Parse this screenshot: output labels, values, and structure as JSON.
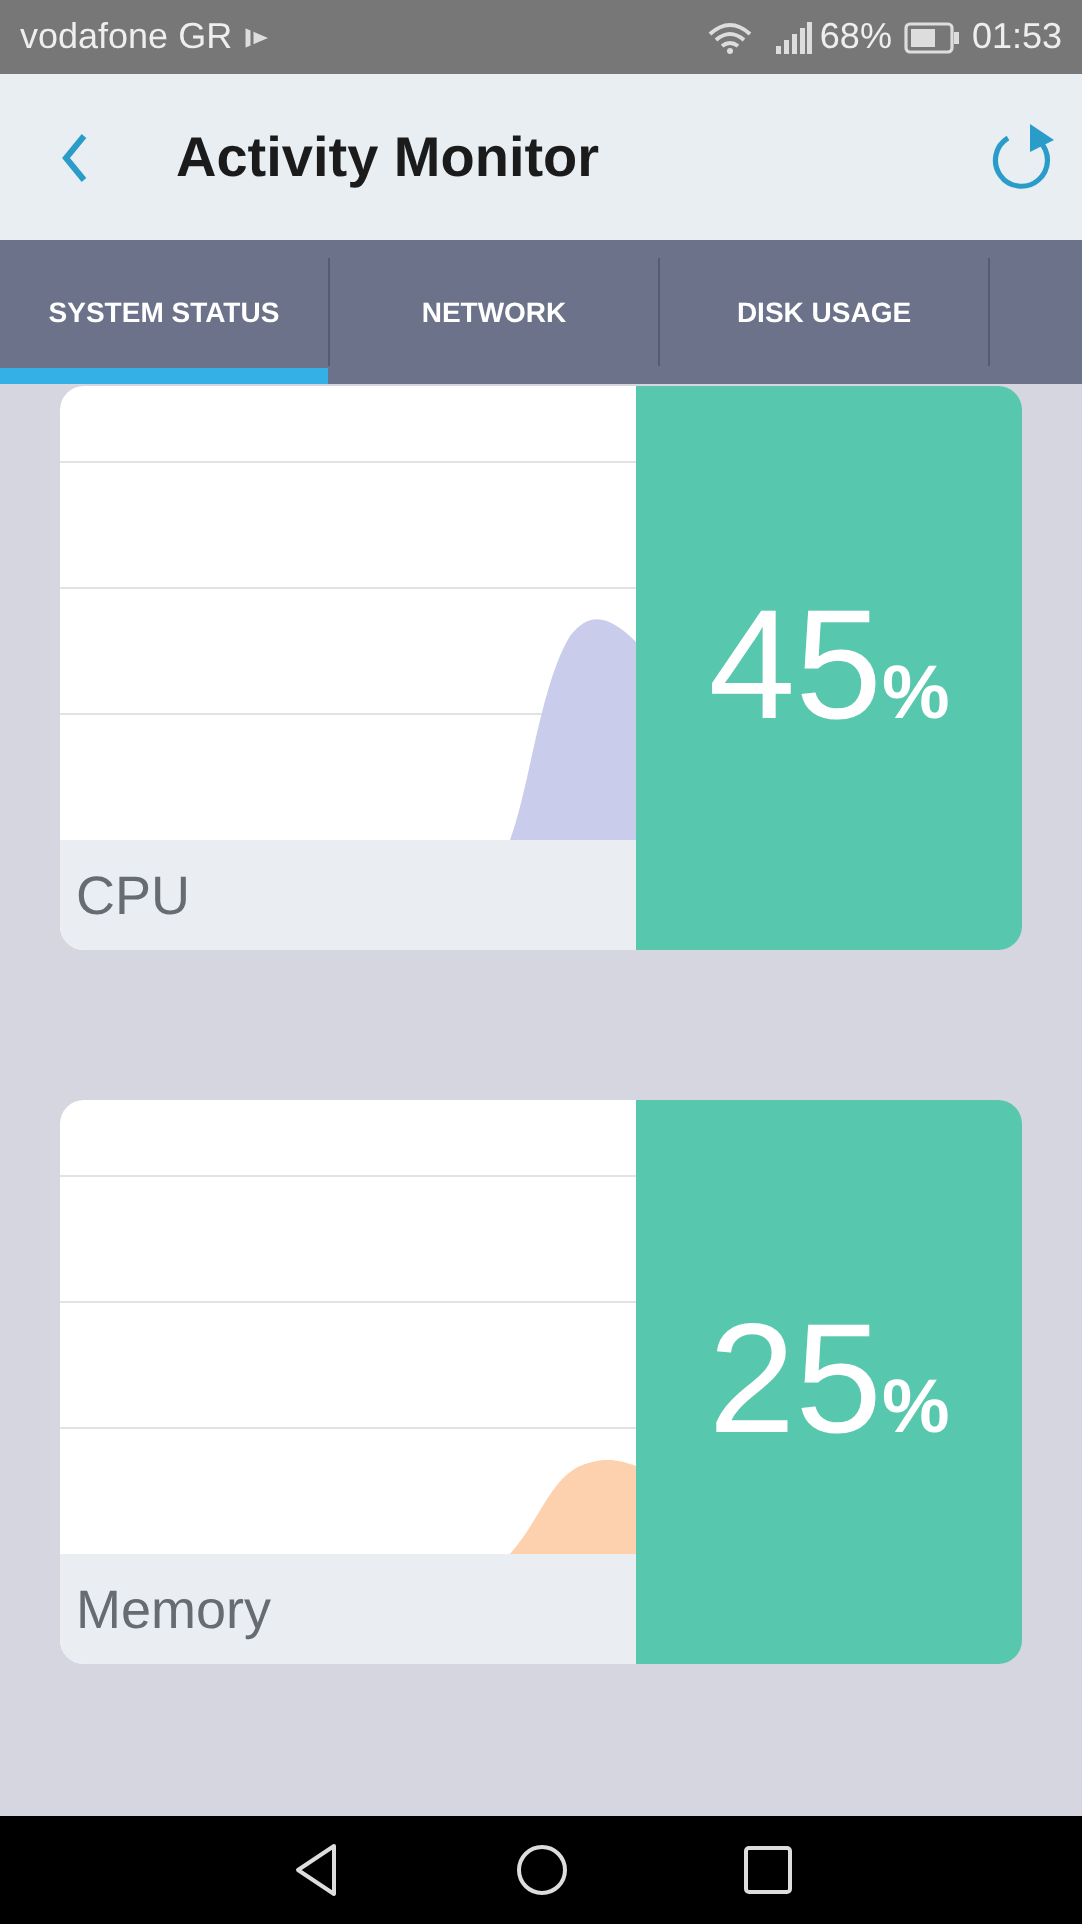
{
  "status_bar": {
    "carrier": "vodafone GR",
    "battery": "68%",
    "time": "01:53"
  },
  "app_bar": {
    "title": "Activity Monitor"
  },
  "tabs": [
    {
      "label": "SYSTEM STATUS",
      "selected": true
    },
    {
      "label": "NETWORK",
      "selected": false
    },
    {
      "label": "DISK USAGE",
      "selected": false
    }
  ],
  "cards": [
    {
      "label": "CPU",
      "value": "45",
      "unit": "%",
      "color": "#cacceb"
    },
    {
      "label": "Memory",
      "value": "25",
      "unit": "%",
      "color": "#fdd1ae"
    }
  ]
}
